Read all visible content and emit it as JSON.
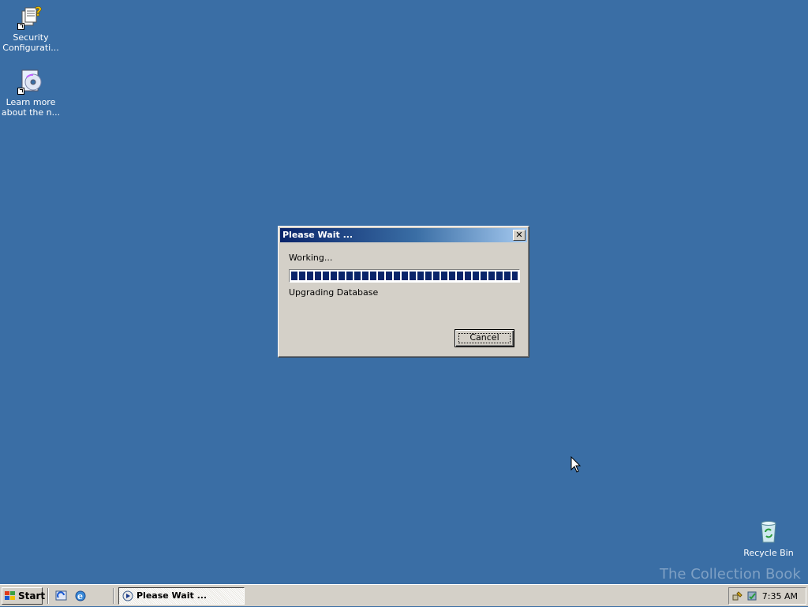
{
  "desktop": {
    "icons": [
      {
        "label_line1": "Security",
        "label_line2": "Configurati...",
        "icon": "security-config-icon"
      },
      {
        "label_line1": "Learn more",
        "label_line2": "about the n...",
        "icon": "cd-help-icon"
      },
      {
        "label_line1": "Recycle Bin",
        "icon": "recycle-bin-icon"
      }
    ]
  },
  "dialog": {
    "title": "Please Wait ...",
    "close_glyph": "✕",
    "working_text": "Working...",
    "progress_percent": 100,
    "status_text": "Upgrading Database",
    "cancel_label": "Cancel"
  },
  "taskbar": {
    "start_label": "Start",
    "task_button_label": "Please Wait ...",
    "clock": "7:35 AM",
    "quick_launch": [
      "show-desktop-icon",
      "internet-explorer-icon"
    ]
  },
  "watermark": "The Collection Book",
  "colors": {
    "desktop": "#3a6ea5",
    "title_active": "#0a246a",
    "window_face": "#d4d0c8"
  }
}
